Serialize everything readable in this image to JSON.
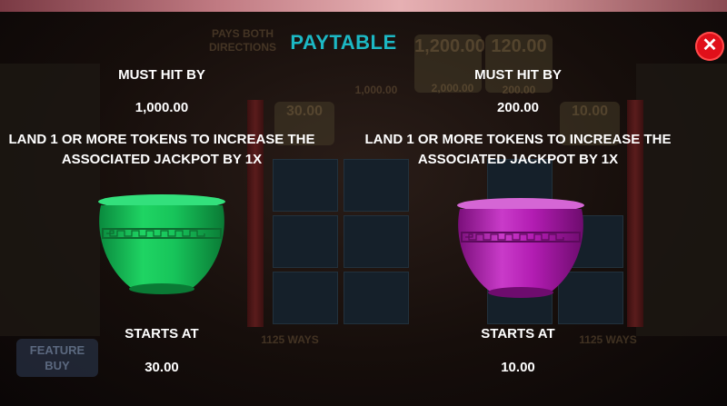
{
  "title": "PAYTABLE",
  "close_button": {
    "icon": "close-icon",
    "label": "✕",
    "color": "#e0101a"
  },
  "jackpots": [
    {
      "must_hit_label": "MUST HIT BY",
      "must_hit_value": "1,000.00",
      "description": "LAND 1 OR MORE TOKENS TO INCREASE THE ASSOCIATED JACKPOT BY 1X",
      "pot_color": "#17c45a",
      "pot_icon": "green-pot-icon",
      "starts_at_label": "STARTS AT",
      "starts_at_value": "30.00"
    },
    {
      "must_hit_label": "MUST HIT BY",
      "must_hit_value": "200.00",
      "description": "LAND 1 OR MORE TOKENS TO INCREASE THE ASSOCIATED JACKPOT BY 1X",
      "pot_color": "#b21cb2",
      "pot_icon": "purple-pot-icon",
      "starts_at_label": "STARTS AT",
      "starts_at_value": "10.00"
    }
  ],
  "background": {
    "ways_banner": "PAYS BOTH DIRECTIONS",
    "jackpot_values": [
      "1,200.00",
      "120.00",
      "30.00",
      "10.00"
    ],
    "must_hit_values": [
      "1,000.00",
      "2,000.00",
      "200.00"
    ],
    "ways_label": "1125 WAYS",
    "feature_buy": "FEATURE BUY"
  }
}
